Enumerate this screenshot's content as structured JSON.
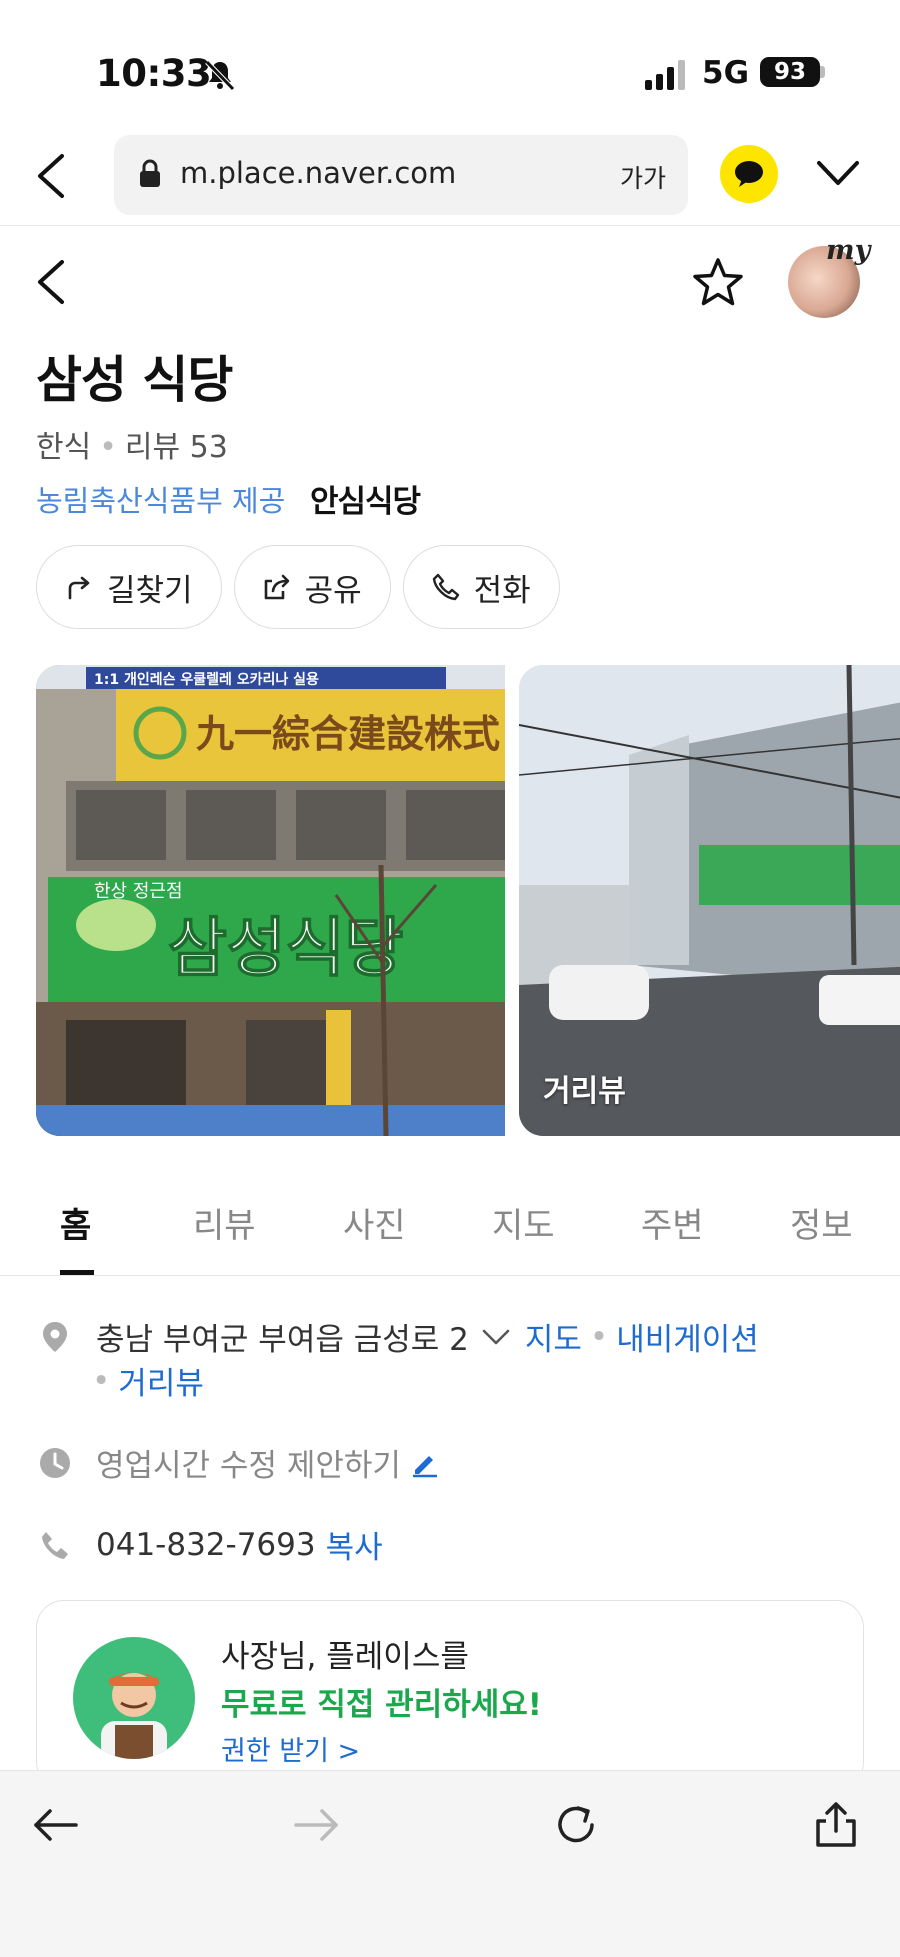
{
  "status_bar": {
    "time": "10:33",
    "network": "5G",
    "battery": "93"
  },
  "browser": {
    "url": "m.place.naver.com",
    "text_size_label": "가가"
  },
  "place": {
    "name": "삼성 식당",
    "category": "한식",
    "review_label": "리뷰 53",
    "certifier": "농림축산식품부 제공",
    "certification": "안심식당"
  },
  "actions": [
    {
      "label": "길찾기",
      "icon": "directions-icon"
    },
    {
      "label": "공유",
      "icon": "share-icon"
    },
    {
      "label": "전화",
      "icon": "phone-icon"
    }
  ],
  "photos": {
    "photo1_signs": {
      "top_banner": "1:1 개인레슨 우쿨렐레 오카리나 실용",
      "company": "九一綜合建設株式",
      "restaurant": "삼성식당",
      "sub": "한상 정근점"
    },
    "streetview_label": "거리뷰"
  },
  "tabs": [
    "홈",
    "리뷰",
    "사진",
    "지도",
    "주변",
    "정보"
  ],
  "active_tab": "홈",
  "info": {
    "address": "충남 부여군 부여읍 금성로 2",
    "map_link": "지도",
    "navigation_link": "내비게이션",
    "streetview_link": "거리뷰",
    "hours_suggest": "영업시간 수정 제안하기",
    "phone": "041-832-7693",
    "copy_label": "복사"
  },
  "promo": {
    "line1": "사장님, 플레이스를",
    "line2": "무료로 직접 관리하세요!",
    "cta": "권한 받기 >"
  },
  "colors": {
    "accent_blue": "#1f6cd1",
    "green": "#19a94c",
    "kakao_yellow": "#fee500"
  }
}
